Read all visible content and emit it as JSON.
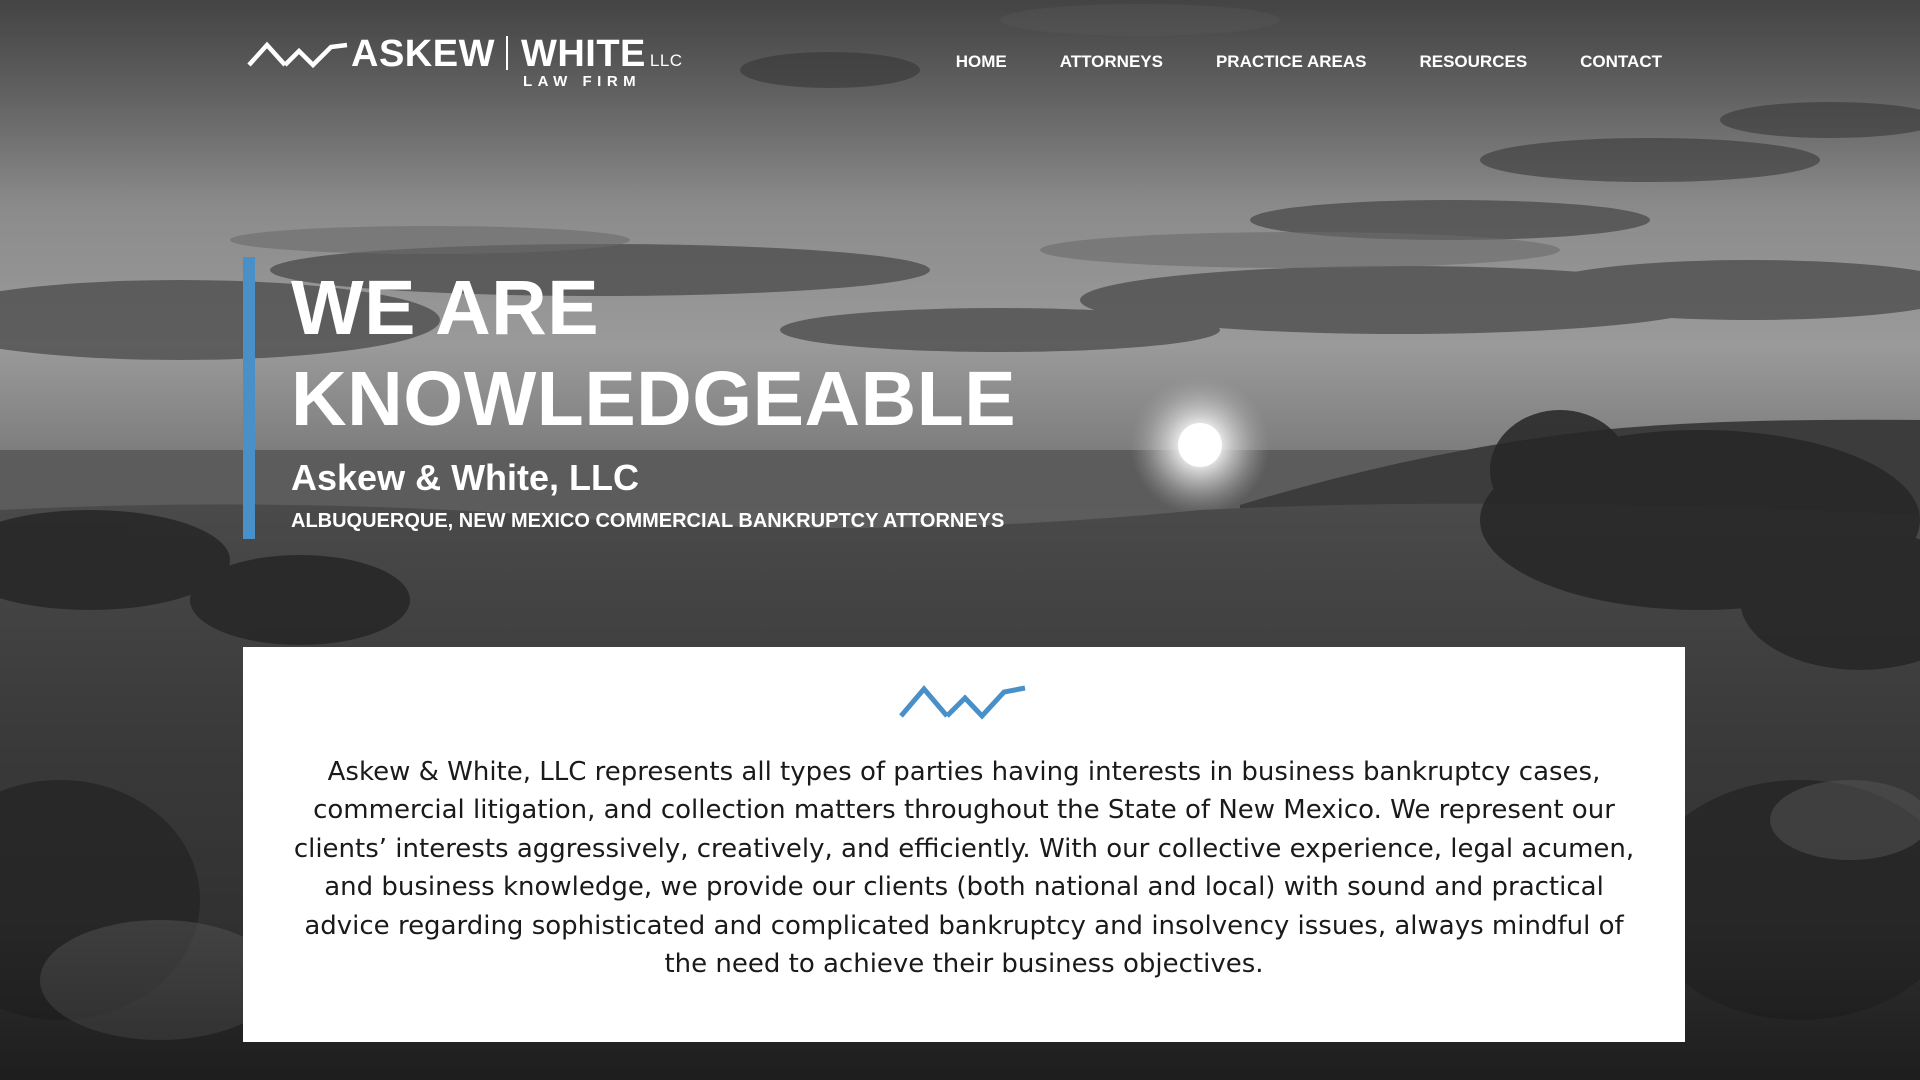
{
  "brand": {
    "name_left": "ASKEW",
    "name_right": "WHITE",
    "suffix": "LLC",
    "tagline": "LAW FIRM",
    "mark_icon": "zigzag-mountain-logo-mark"
  },
  "nav": {
    "items": [
      {
        "label": "HOME"
      },
      {
        "label": "ATTORNEYS"
      },
      {
        "label": "PRACTICE AREAS"
      },
      {
        "label": "RESOURCES"
      },
      {
        "label": "CONTACT"
      }
    ]
  },
  "hero": {
    "title_line1": "WE ARE",
    "title_line2": "KNOWLEDGEABLE",
    "subtitle": "Askew & White, LLC",
    "tagline": "ALBUQUERQUE, NEW MEXICO COMMERCIAL BANKRUPTCY ATTORNEYS",
    "background": "grayscale-desert-sunset-photo"
  },
  "intro": {
    "icon": "zigzag-mountain-logo-mark",
    "text": "Askew & White, LLC represents all types of parties having interests in business bankruptcy cases, commercial litigation, and collection matters throughout the State of New Mexico. We represent our clients’ interests aggressively, creatively, and efficiently. With our collective experience, legal acumen, and business knowledge, we provide our clients (both national and local) with sound and practical advice regarding sophisticated and complicated bankruptcy and insolvency issues, always mindful of the need to achieve their business objectives."
  },
  "colors": {
    "accent": "#4a90c8",
    "text_dark": "#1a1a1a",
    "card_bg": "#ffffff"
  }
}
